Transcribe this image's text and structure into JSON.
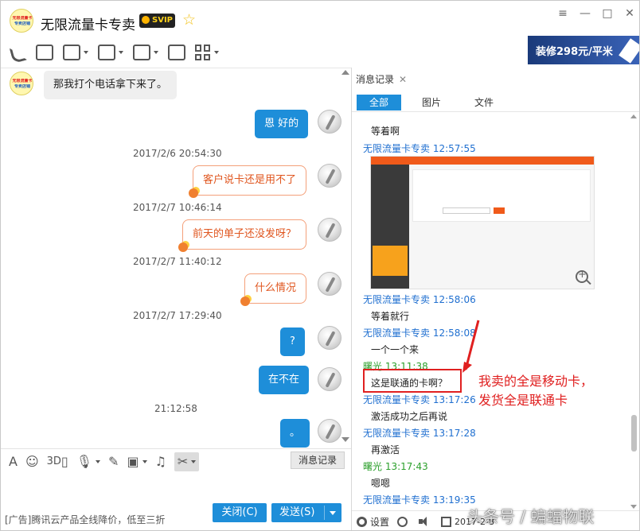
{
  "window": {
    "title": "无限流量卡专卖",
    "vip_badge": "SVIP",
    "avatar_text_line1": "无限流量卡",
    "avatar_text_line2": "专卖店铺",
    "controls": {
      "menu": "≡",
      "minimize": "—",
      "maximize": "□",
      "close": "✕"
    }
  },
  "toolbar": {
    "items": [
      "phone-icon",
      "video-icon",
      "screen-share-icon",
      "file-transfer-icon",
      "remote-desktop-icon",
      "add-contact-icon",
      "app-grid-icon"
    ]
  },
  "ad_banner": {
    "text": "装修298元/平米"
  },
  "chat": {
    "messages": [
      {
        "side": "left",
        "style": "recv",
        "text": "那我打个电话拿下来了。"
      },
      {
        "side": "right",
        "style": "blue",
        "text": "恩 好的"
      },
      {
        "time": "2017/2/6 20:54:30"
      },
      {
        "side": "right",
        "style": "lace",
        "text": "客户说卡还是用不了"
      },
      {
        "time": "2017/2/7 10:46:14"
      },
      {
        "side": "right",
        "style": "lace",
        "text": "前天的单子还没发呀？"
      },
      {
        "time": "2017/2/7 11:40:12"
      },
      {
        "side": "right",
        "style": "lace",
        "text": "什么情况"
      },
      {
        "time": "2017/2/7 17:29:40"
      },
      {
        "side": "right",
        "style": "blue",
        "text": "?"
      },
      {
        "side": "right",
        "style": "blue",
        "text": "在不在"
      },
      {
        "time": "21:12:58"
      },
      {
        "side": "right",
        "style": "blue",
        "text": "。"
      }
    ]
  },
  "input_toolbar": {
    "font": "A",
    "emoji": "☺",
    "threed": "3D",
    "history_toggle": "消息记录"
  },
  "bottom": {
    "ad": "[广告]腾讯云产品全线降价，低至三折",
    "close_label": "关闭(C)",
    "send_label": "发送(S)"
  },
  "history": {
    "tab_label": "消息记录",
    "filters": [
      "全部",
      "图片",
      "文件"
    ],
    "entries": [
      {
        "type": "msg",
        "text": "等着啊"
      },
      {
        "type": "sender",
        "name": "无限流量卡专卖",
        "time": "12:57:55",
        "color": "blue"
      },
      {
        "type": "image"
      },
      {
        "type": "sender",
        "name": "无限流量卡专卖",
        "time": "12:58:06",
        "color": "blue"
      },
      {
        "type": "msg",
        "text": "等着就行"
      },
      {
        "type": "sender",
        "name": "无限流量卡专卖",
        "time": "12:58:08",
        "color": "blue"
      },
      {
        "type": "msg",
        "text": "一个一个来"
      },
      {
        "type": "sender",
        "name": "曙光",
        "time": "13:11:38",
        "color": "green"
      },
      {
        "type": "msg",
        "text": "这是联通的卡啊？"
      },
      {
        "type": "sender",
        "name": "无限流量卡专卖",
        "time": "13:17:26",
        "color": "blue"
      },
      {
        "type": "msg",
        "text": "激活成功之后再说"
      },
      {
        "type": "sender",
        "name": "无限流量卡专卖",
        "time": "13:17:28",
        "color": "blue"
      },
      {
        "type": "msg",
        "text": "再激活"
      },
      {
        "type": "sender",
        "name": "曙光",
        "time": "13:17:43",
        "color": "green"
      },
      {
        "type": "msg",
        "text": "嗯嗯"
      },
      {
        "type": "sender",
        "name": "无限流量卡专卖",
        "time": "13:19:35",
        "color": "blue"
      }
    ],
    "annotation_line1": "我卖的全是移动卡，",
    "annotation_line2": "发货全是联通卡",
    "footer": {
      "settings_label": "设置",
      "date": "2017-2-8"
    }
  },
  "watermark": "头条号 / 蝙蝠物联",
  "colors": {
    "accent_blue": "#1e8ed9",
    "sender_blue": "#1f6fd0",
    "sender_green": "#2ca02c",
    "annotation_red": "#e02020"
  }
}
